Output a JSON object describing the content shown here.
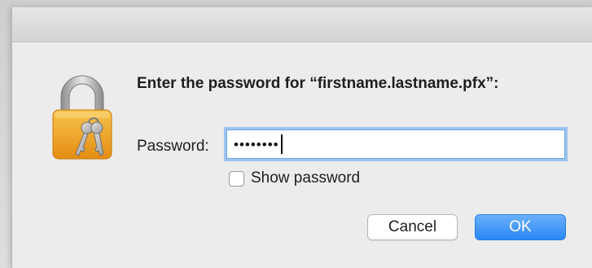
{
  "dialog": {
    "prompt": "Enter the password for “firstname.lastname.pfx”:",
    "password_label": "Password:",
    "password_value": "••••••••",
    "show_password_label": "Show password",
    "show_password_checked": false,
    "cancel_label": "Cancel",
    "ok_label": "OK"
  },
  "icons": {
    "lock": "padlock-with-keys-icon"
  },
  "colors": {
    "accent": "#2b87f5",
    "focus_ring": "#9cc3f0",
    "lock_body": "#f2a024"
  }
}
